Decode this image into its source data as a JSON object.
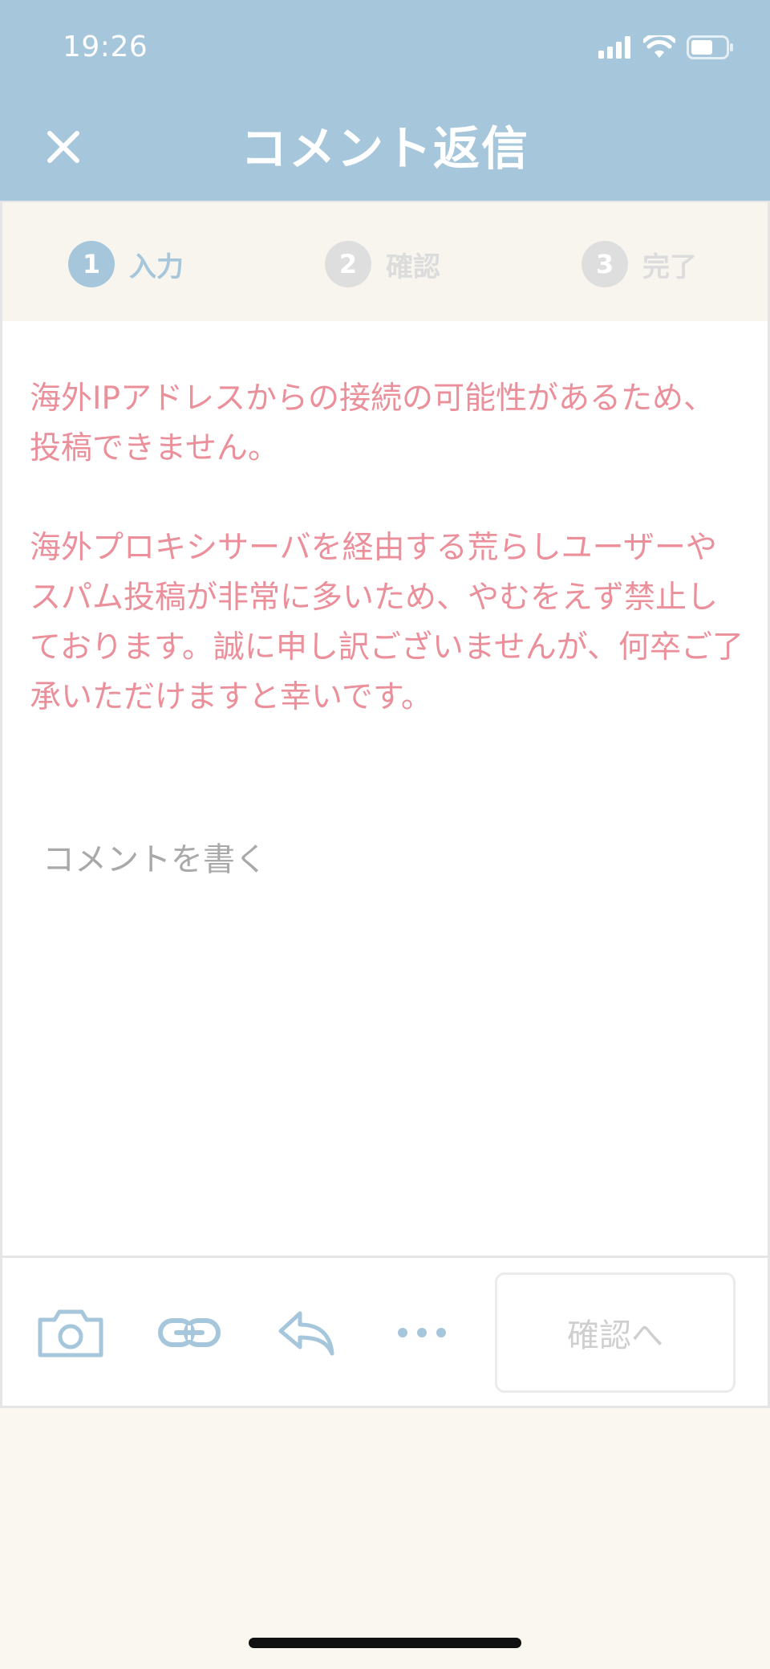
{
  "status": {
    "time": "19:26"
  },
  "header": {
    "title": "コメント返信"
  },
  "steps": [
    {
      "number": "1",
      "label": "入力"
    },
    {
      "number": "2",
      "label": "確認"
    },
    {
      "number": "3",
      "label": "完了"
    }
  ],
  "error": {
    "paragraph1": "海外IPアドレスからの接続の可能性があるため、投稿できません。",
    "paragraph2": "海外プロキシサーバを経由する荒らしユーザーやスパム投稿が非常に多いため、やむをえず禁止しております。誠に申し訳ございませんが、何卒ご了承いただけますと幸いです。"
  },
  "comment": {
    "placeholder": "コメントを書く",
    "value": ""
  },
  "toolbar": {
    "confirm_label": "確認へ"
  },
  "colors": {
    "header": "#a6c6dc",
    "accent": "#a6c6dc",
    "error": "#eb8f9a",
    "inactive": "#dedede"
  },
  "icons": {
    "close": "close-icon",
    "camera": "camera-icon",
    "link": "link-icon",
    "reply": "reply-icon",
    "more": "more-icon"
  }
}
